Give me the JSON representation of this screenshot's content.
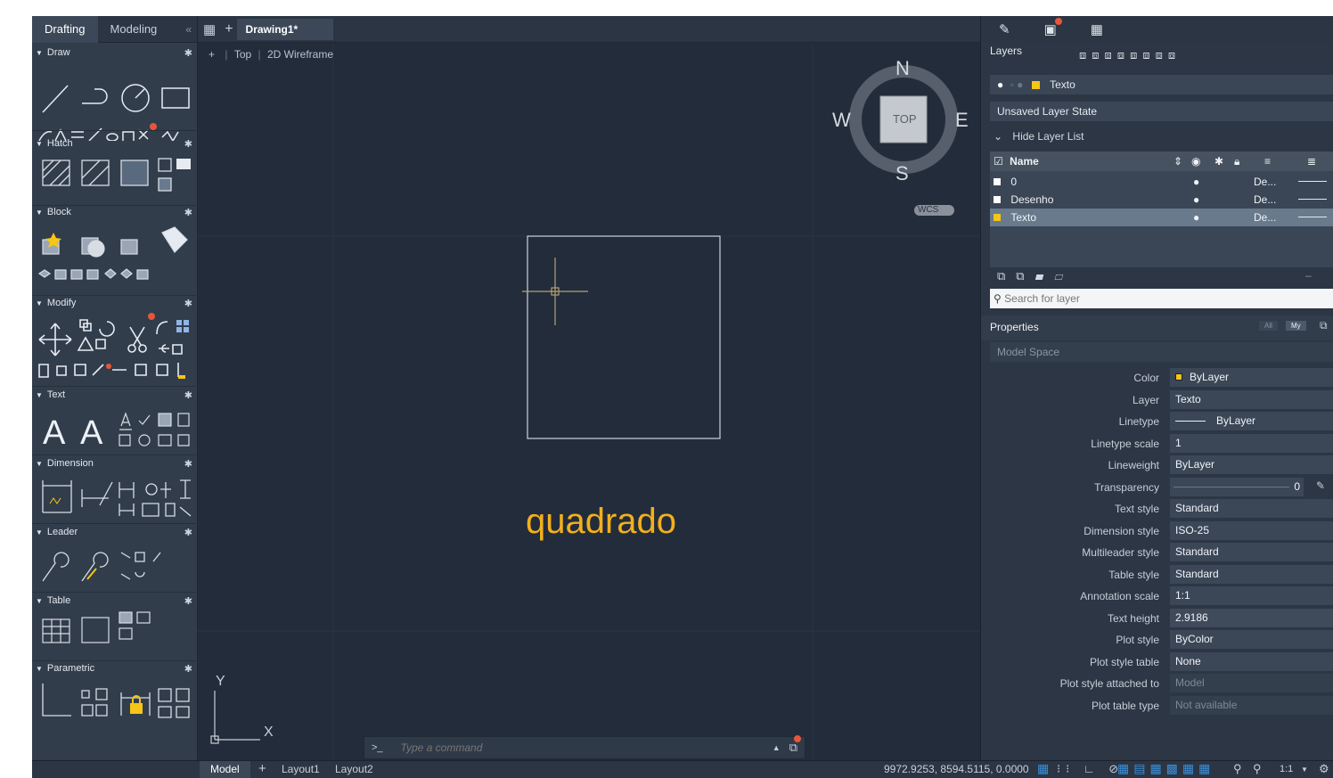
{
  "workspace_tabs": {
    "drafting": "Drafting",
    "modeling": "Modeling",
    "collapse": "«"
  },
  "sections": {
    "draw": "Draw",
    "hatch": "Hatch",
    "block": "Block",
    "modify": "Modify",
    "text": "Text",
    "dimension": "Dimension",
    "leader": "Leader",
    "table": "Table",
    "parametric": "Parametric"
  },
  "document": {
    "tab": "Drawing1*",
    "view_prefix": "+",
    "view_name": "Top",
    "visual_style": "2D Wireframe"
  },
  "viewcube": {
    "north": "N",
    "south": "S",
    "east": "E",
    "west": "W",
    "face": "TOP",
    "ucs": "WCS"
  },
  "drawing": {
    "text": "quadrado",
    "text_color": "#f2b01e"
  },
  "ucs_icon": {
    "x": "X",
    "y": "Y"
  },
  "command": {
    "prompt": ">_",
    "placeholder": "Type a command"
  },
  "layers": {
    "title": "Layers",
    "current_layer": "Texto",
    "layer_state": "Unsaved Layer State",
    "hide_list": "Hide Layer List",
    "col_name": "Name",
    "rows": [
      {
        "name": "0",
        "linetype": "De...",
        "color": "#ffffff"
      },
      {
        "name": "Desenho",
        "linetype": "De...",
        "color": "#ffffff"
      },
      {
        "name": "Texto",
        "linetype": "De...",
        "color": "#f5c518"
      }
    ],
    "search_placeholder": "Search for layer"
  },
  "properties": {
    "title": "Properties",
    "filter_all": "All",
    "filter_my": "My",
    "space": "Model Space",
    "rows": [
      {
        "label": "Color",
        "value": "ByLayer"
      },
      {
        "label": "Layer",
        "value": "Texto"
      },
      {
        "label": "Linetype",
        "value": "ByLayer"
      },
      {
        "label": "Linetype scale",
        "value": "1"
      },
      {
        "label": "Lineweight",
        "value": "ByLayer"
      },
      {
        "label": "Transparency",
        "value": "0"
      },
      {
        "label": "Text style",
        "value": "Standard"
      },
      {
        "label": "Dimension style",
        "value": "ISO-25"
      },
      {
        "label": "Multileader style",
        "value": "Standard"
      },
      {
        "label": "Table style",
        "value": "Standard"
      },
      {
        "label": "Annotation scale",
        "value": "1:1"
      },
      {
        "label": "Text height",
        "value": "2.9186"
      },
      {
        "label": "Plot style",
        "value": "ByColor"
      },
      {
        "label": "Plot style table",
        "value": "None"
      },
      {
        "label": "Plot style attached to",
        "value": "Model"
      },
      {
        "label": "Plot table type",
        "value": "Not available"
      }
    ]
  },
  "status": {
    "model": "Model",
    "layout1": "Layout1",
    "layout2": "Layout2",
    "coords": "9972.9253, 8594.5115, 0.0000",
    "scale": "1:1"
  },
  "colors": {
    "accent": "#3b8fd9",
    "layer_yellow": "#f5c518",
    "notify": "#e8553a"
  }
}
